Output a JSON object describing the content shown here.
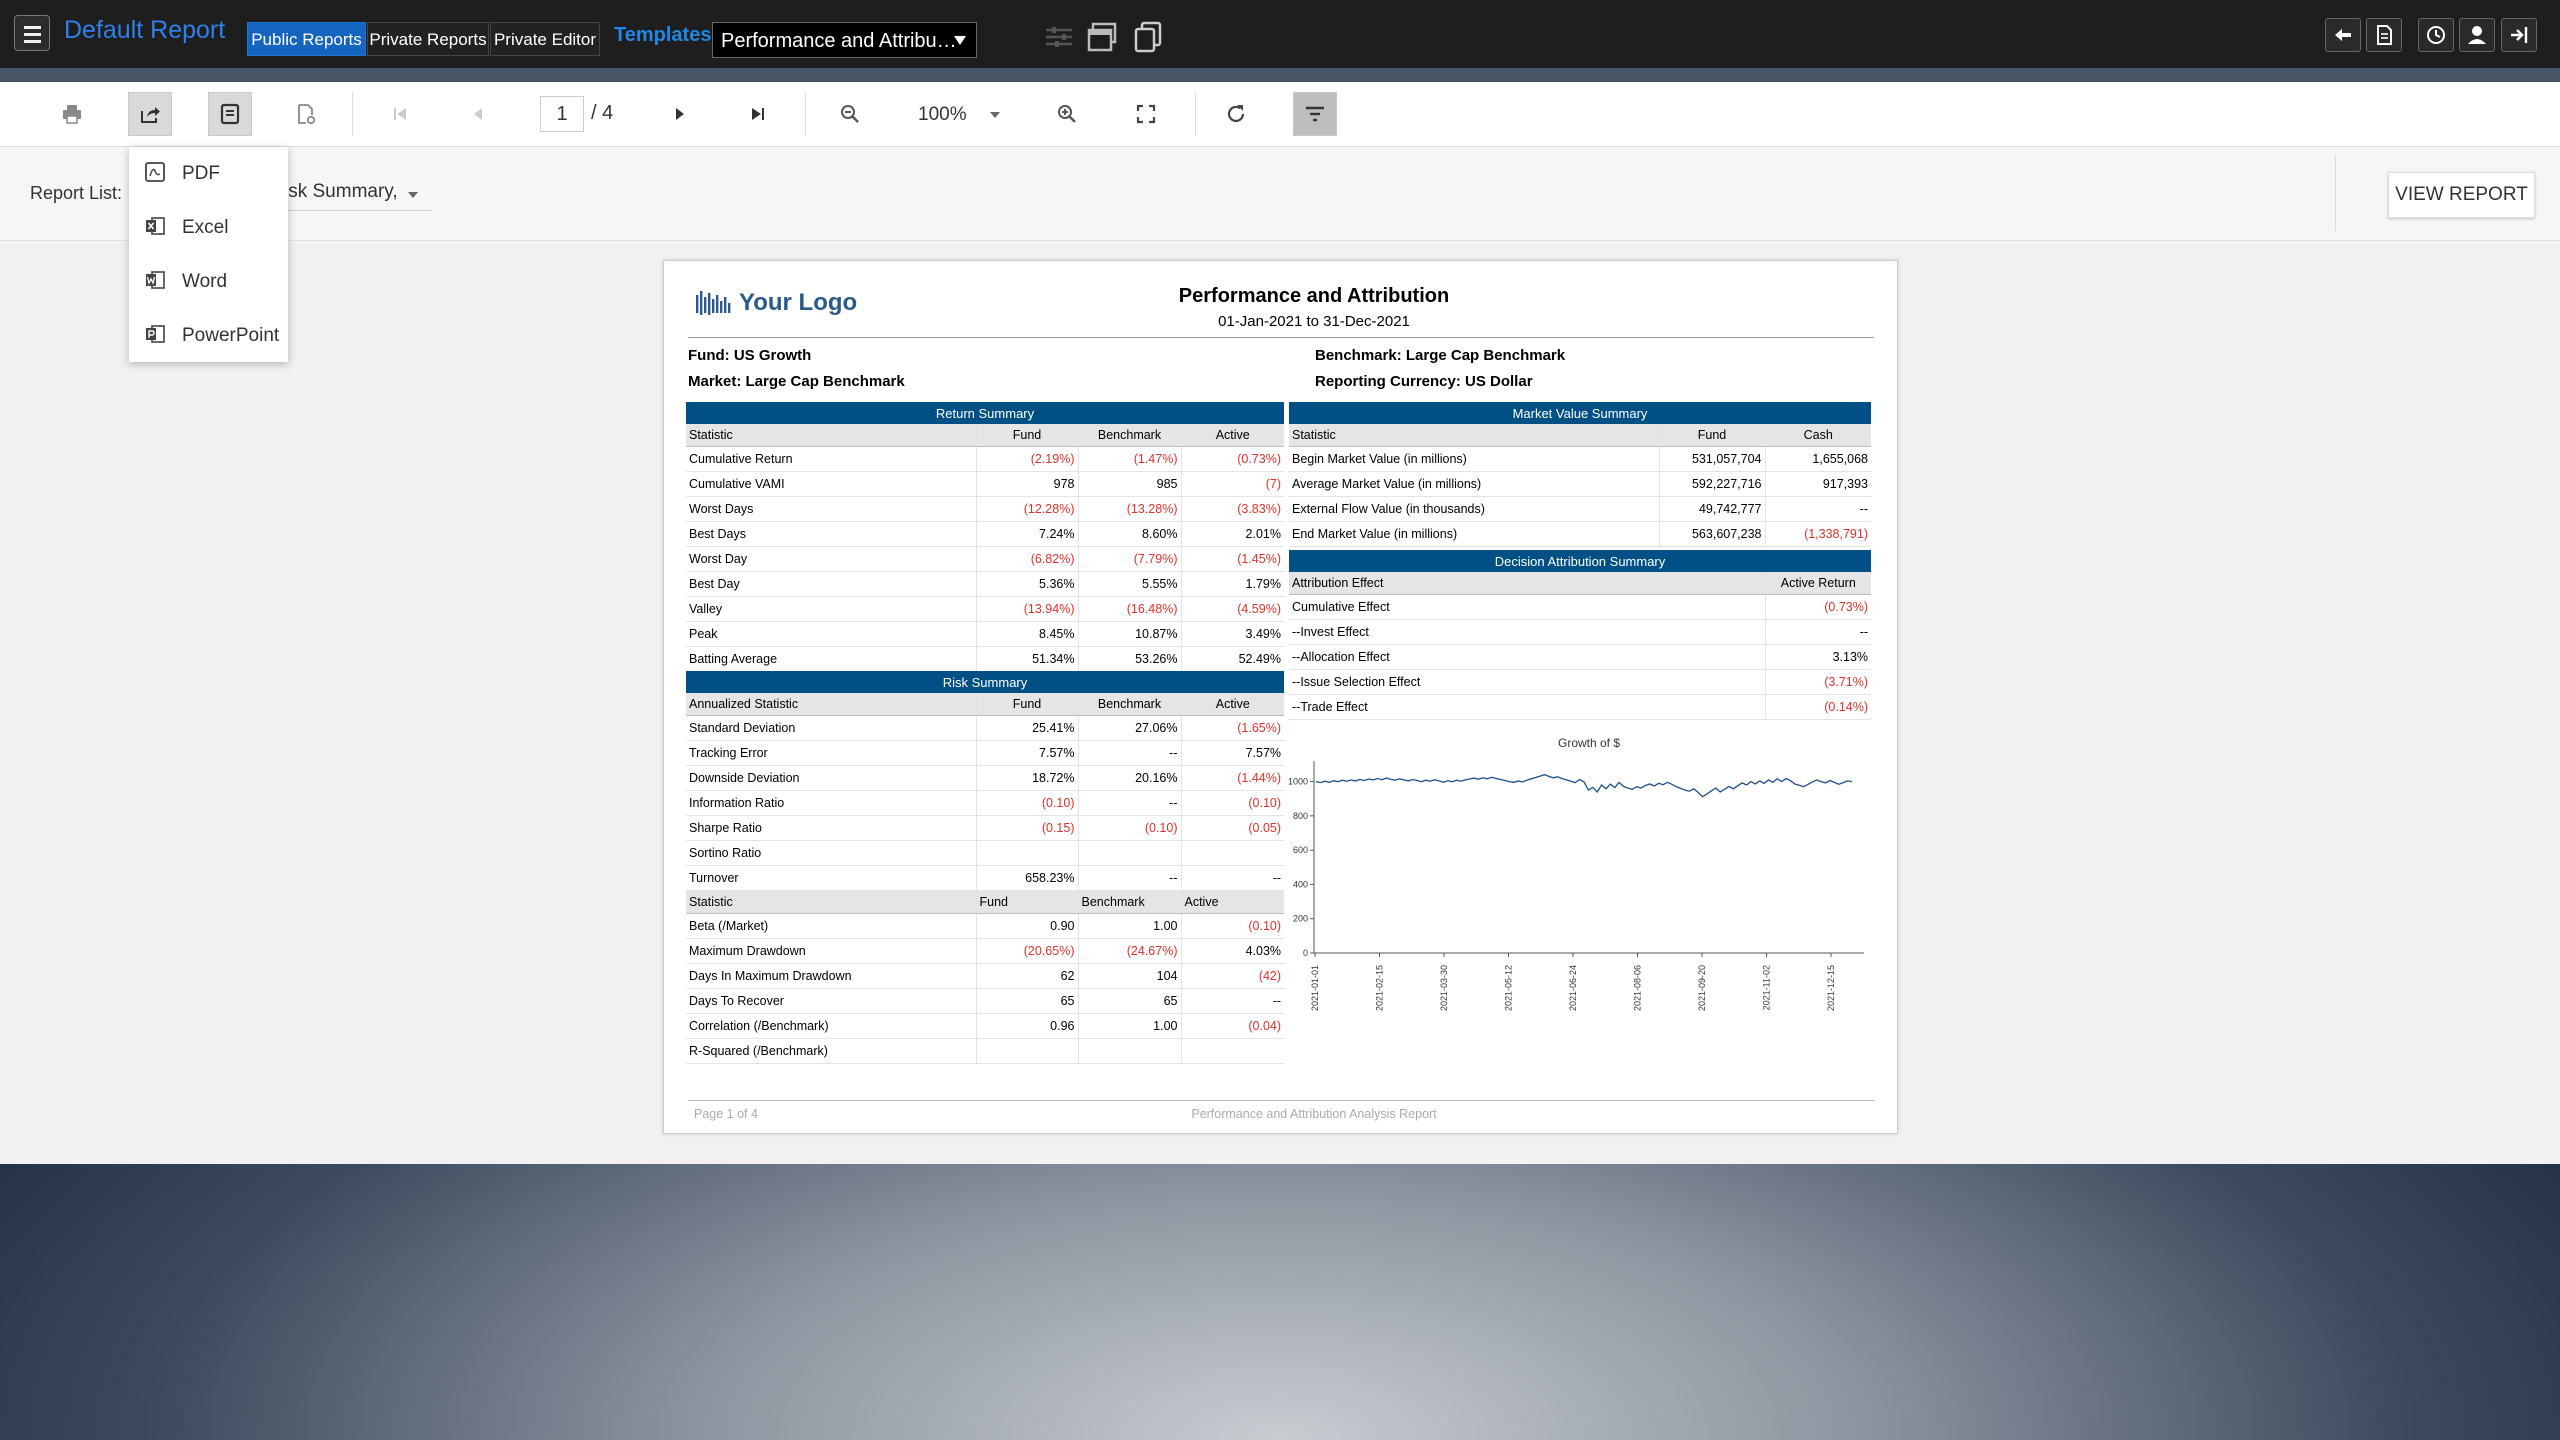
{
  "app": {
    "title": "Default Report",
    "tabs": [
      "Public Reports",
      "Private Reports",
      "Private Editor"
    ],
    "templates_label": "Templates",
    "template_select": "Performance and Attribu…"
  },
  "toolbar": {
    "page_current": "1",
    "page_total": "/ 4",
    "zoom": "100%"
  },
  "params": {
    "report_list_label": "Report List:",
    "report_list_value": "isk Summary,",
    "view_report": "VIEW REPORT"
  },
  "export_menu": [
    "PDF",
    "Excel",
    "Word",
    "PowerPoint"
  ],
  "report": {
    "logo_text": "Your Logo",
    "title": "Performance and Attribution",
    "date_range": "01-Jan-2021 to 31-Dec-2021",
    "fund": "Fund: US Growth",
    "market": "Market: Large Cap Benchmark",
    "benchmark": "Benchmark: Large Cap Benchmark",
    "currency": "Reporting Currency: US Dollar",
    "return_summary": {
      "title": "Return Summary",
      "headers": [
        "Statistic",
        "Fund",
        "Benchmark",
        "Active"
      ],
      "rows": [
        [
          "Cumulative Return",
          "(2.19%)",
          "(1.47%)",
          "(0.73%)"
        ],
        [
          "Cumulative VAMI",
          "978",
          "985",
          "(7)"
        ],
        [
          "Worst  Days",
          "(12.28%)",
          "(13.28%)",
          "(3.83%)"
        ],
        [
          "Best  Days",
          "7.24%",
          "8.60%",
          "2.01%"
        ],
        [
          "Worst Day",
          "(6.82%)",
          "(7.79%)",
          "(1.45%)"
        ],
        [
          "Best Day",
          "5.36%",
          "5.55%",
          "1.79%"
        ],
        [
          "Valley",
          "(13.94%)",
          "(16.48%)",
          "(4.59%)"
        ],
        [
          "Peak",
          "8.45%",
          "10.87%",
          "3.49%"
        ],
        [
          "Batting Average",
          "51.34%",
          "53.26%",
          "52.49%"
        ]
      ]
    },
    "risk_summary": {
      "title": "Risk Summary",
      "headers": [
        "Annualized Statistic",
        "Fund",
        "Benchmark",
        "Active"
      ],
      "rows": [
        [
          "Standard Deviation",
          "25.41%",
          "27.06%",
          "(1.65%)"
        ],
        [
          "Tracking Error",
          "7.57%",
          "--",
          "7.57%"
        ],
        [
          "Downside Deviation",
          "18.72%",
          "20.16%",
          "(1.44%)"
        ],
        [
          "Information Ratio",
          "(0.10)",
          "--",
          "(0.10)"
        ],
        [
          "Sharpe Ratio",
          "(0.15)",
          "(0.10)",
          "(0.05)"
        ],
        [
          "Sortino Ratio",
          "",
          "",
          ""
        ],
        [
          "Turnover",
          "658.23%",
          "--",
          "--"
        ]
      ],
      "headers2": [
        "Statistic",
        "Fund",
        "Benchmark",
        "Active"
      ],
      "rows2": [
        [
          "Beta (/Market)",
          "0.90",
          "1.00",
          "(0.10)"
        ],
        [
          "Maximum Drawdown",
          "(20.65%)",
          "(24.67%)",
          "4.03%"
        ],
        [
          "Days In Maximum Drawdown",
          "62",
          "104",
          "(42)"
        ],
        [
          "Days To Recover",
          "65",
          "65",
          "--"
        ],
        [
          "Correlation (/Benchmark)",
          "0.96",
          "1.00",
          "(0.04)"
        ],
        [
          "R-Squared (/Benchmark)",
          "",
          "",
          ""
        ]
      ]
    },
    "market_value_summary": {
      "title": "Market Value Summary",
      "headers": [
        "Statistic",
        "Fund",
        "Cash"
      ],
      "rows": [
        [
          "Begin Market Value (in millions)",
          "531,057,704",
          "1,655,068"
        ],
        [
          "Average Market Value (in millions)",
          "592,227,716",
          "917,393"
        ],
        [
          "External Flow Value (in thousands)",
          "49,742,777",
          "--"
        ],
        [
          "End Market Value (in millions)",
          "563,607,238",
          "(1,338,791)"
        ]
      ]
    },
    "decision_attribution": {
      "title": "Decision Attribution Summary",
      "headers": [
        "Attribution Effect",
        "Active Return"
      ],
      "rows": [
        [
          "Cumulative Effect",
          "(0.73%)"
        ],
        [
          "--Invest Effect",
          "--"
        ],
        [
          "--Allocation Effect",
          "3.13%"
        ],
        [
          "--Issue Selection Effect",
          "(3.71%)"
        ],
        [
          "--Trade Effect",
          "(0.14%)"
        ]
      ]
    },
    "footer_page": "Page 1 of 4",
    "footer_title": "Performance and Attribution Analysis Report"
  },
  "chart_data": {
    "type": "line",
    "title": "Growth of $",
    "xlabel": "",
    "ylabel": "",
    "ylim": [
      0,
      1120
    ],
    "yticks": [
      0,
      200,
      400,
      600,
      800,
      1000
    ],
    "xticks": [
      "2021-01-01",
      "2021-02-15",
      "2021-03-30",
      "2021-05-12",
      "2021-06-24",
      "2021-08-06",
      "2021-09-20",
      "2021-11-02",
      "2021-12-15"
    ],
    "grid": false,
    "series": [
      {
        "values": [
          1000,
          994,
          1002,
          996,
          1005,
          999,
          1008,
          1002,
          1010,
          1004,
          1012,
          1006,
          1015,
          1009,
          1018,
          1011,
          1020,
          1014,
          1008,
          1016,
          1010,
          1004,
          1012,
          1006,
          999,
          1008,
          1002,
          1011,
          1004,
          996,
          1005,
          999,
          1008,
          1002,
          1010,
          1015,
          1020,
          1013,
          1022,
          1016,
          1025,
          1018,
          1012,
          1006,
          1000,
          995,
          1003,
          998,
          1008,
          1016,
          1024,
          1032,
          1040,
          1030,
          1022,
          1028,
          1018,
          1010,
          1002,
          994,
          1012,
          998,
          950,
          966,
          940,
          980,
          958,
          985,
          965,
          995,
          972,
          962,
          955,
          970,
          962,
          978,
          986,
          974,
          990,
          982,
          996,
          984,
          970,
          960,
          950,
          944,
          958,
          936,
          912,
          928,
          946,
          962,
          940,
          955,
          972,
          958,
          976,
          992,
          980,
          1000,
          986,
          1004,
          990,
          1010,
          996,
          1016,
          1000,
          1018,
          1005,
          986,
          978,
          970,
          984,
          998,
          1010,
          1000,
          992,
          1006,
          995,
          984,
          994,
          1004,
          1000
        ]
      }
    ]
  }
}
